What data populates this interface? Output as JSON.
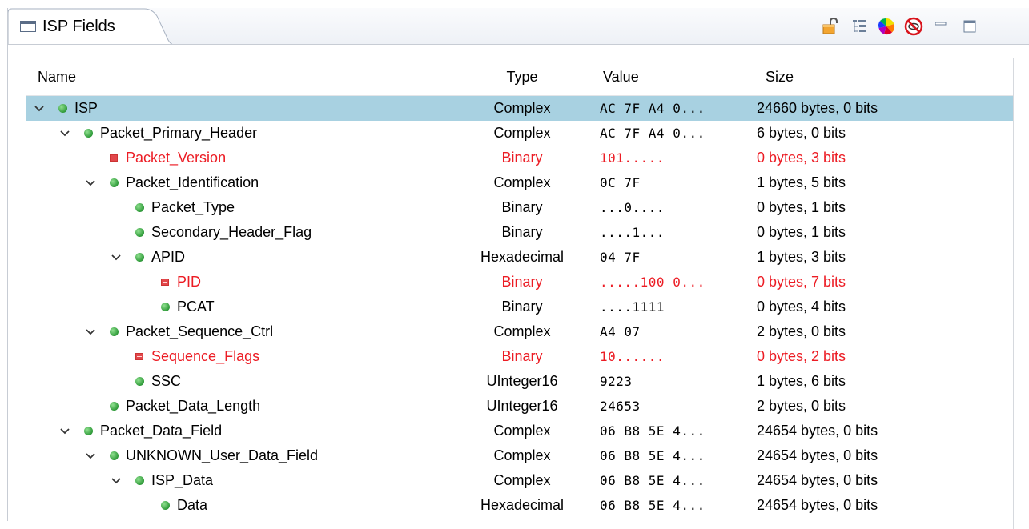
{
  "view": {
    "tab_title": "ISP Fields",
    "tab_icon": "view-icon",
    "toolbar": [
      "lock-open-icon",
      "tree-layout-icon",
      "color-wheel-icon",
      "hide-filter-icon",
      "minimize-icon",
      "maximize-icon"
    ]
  },
  "columns": {
    "name": "Name",
    "type": "Type",
    "value": "Value",
    "size": "Size"
  },
  "colors": {
    "selected_row": "#a8d1e1",
    "error_text": "#ec1c24",
    "node_green": "#2f9a39",
    "node_red": "#e2474b"
  },
  "rows": [
    {
      "name": "ISP",
      "type": "Complex",
      "value": "AC 7F A4 0...",
      "size": "24660 bytes, 0 bits",
      "level": 0,
      "expanded": true,
      "node": "green",
      "error": false,
      "selected": true
    },
    {
      "name": "Packet_Primary_Header",
      "type": "Complex",
      "value": "AC 7F A4 0...",
      "size": "6 bytes, 0 bits",
      "level": 1,
      "expanded": true,
      "node": "green",
      "error": false,
      "selected": false
    },
    {
      "name": "Packet_Version",
      "type": "Binary",
      "value": "101.....",
      "size": "0 bytes, 3 bits",
      "level": 2,
      "expanded": null,
      "node": "red",
      "error": true,
      "selected": false
    },
    {
      "name": "Packet_Identification",
      "type": "Complex",
      "value": "0C 7F",
      "size": "1 bytes, 5 bits",
      "level": 2,
      "expanded": true,
      "node": "green",
      "error": false,
      "selected": false
    },
    {
      "name": "Packet_Type",
      "type": "Binary",
      "value": "...0....",
      "size": "0 bytes, 1 bits",
      "level": 3,
      "expanded": null,
      "node": "green",
      "error": false,
      "selected": false
    },
    {
      "name": "Secondary_Header_Flag",
      "type": "Binary",
      "value": "....1...",
      "size": "0 bytes, 1 bits",
      "level": 3,
      "expanded": null,
      "node": "green",
      "error": false,
      "selected": false
    },
    {
      "name": "APID",
      "type": "Hexadecimal",
      "value": "04 7F",
      "size": "1 bytes, 3 bits",
      "level": 3,
      "expanded": true,
      "node": "green",
      "error": false,
      "selected": false
    },
    {
      "name": "PID",
      "type": "Binary",
      "value": ".....100 0...",
      "size": "0 bytes, 7 bits",
      "level": 4,
      "expanded": null,
      "node": "red",
      "error": true,
      "selected": false
    },
    {
      "name": "PCAT",
      "type": "Binary",
      "value": "....1111",
      "size": "0 bytes, 4 bits",
      "level": 4,
      "expanded": null,
      "node": "green",
      "error": false,
      "selected": false
    },
    {
      "name": "Packet_Sequence_Ctrl",
      "type": "Complex",
      "value": "A4 07",
      "size": "2 bytes, 0 bits",
      "level": 2,
      "expanded": true,
      "node": "green",
      "error": false,
      "selected": false
    },
    {
      "name": "Sequence_Flags",
      "type": "Binary",
      "value": "10......",
      "size": "0 bytes, 2 bits",
      "level": 3,
      "expanded": null,
      "node": "red",
      "error": true,
      "selected": false
    },
    {
      "name": "SSC",
      "type": "UInteger16",
      "value": "9223",
      "size": "1 bytes, 6 bits",
      "level": 3,
      "expanded": null,
      "node": "green",
      "error": false,
      "selected": false
    },
    {
      "name": "Packet_Data_Length",
      "type": "UInteger16",
      "value": "24653",
      "size": "2 bytes, 0 bits",
      "level": 2,
      "expanded": null,
      "node": "green",
      "error": false,
      "selected": false
    },
    {
      "name": "Packet_Data_Field",
      "type": "Complex",
      "value": "06 B8 5E 4...",
      "size": "24654 bytes, 0 bits",
      "level": 1,
      "expanded": true,
      "node": "green",
      "error": false,
      "selected": false
    },
    {
      "name": "UNKNOWN_User_Data_Field",
      "type": "Complex",
      "value": "06 B8 5E 4...",
      "size": "24654 bytes, 0 bits",
      "level": 1,
      "expanded": true,
      "node": "green",
      "error": false,
      "selected": false,
      "indent_override": 2
    },
    {
      "name": "ISP_Data",
      "type": "Complex",
      "value": "06 B8 5E 4...",
      "size": "24654 bytes, 0 bits",
      "level": 2,
      "expanded": true,
      "node": "green",
      "error": false,
      "selected": false,
      "indent_override": 3
    },
    {
      "name": "Data",
      "type": "Hexadecimal",
      "value": "06 B8 5E 4...",
      "size": "24654 bytes, 0 bits",
      "level": 3,
      "expanded": null,
      "node": "green",
      "error": false,
      "selected": false,
      "indent_override": 4
    }
  ]
}
